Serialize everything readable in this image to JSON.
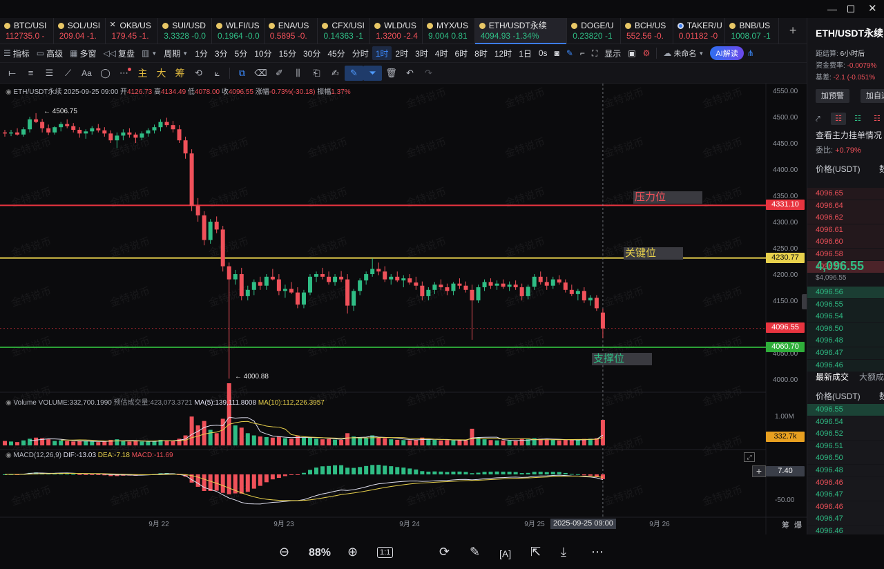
{
  "window": {
    "min_icon": "minimize-icon",
    "max_icon": "maximize-icon",
    "close_icon": "close-icon"
  },
  "tabs": [
    {
      "sym": "BTC/USI",
      "price": "112735.0",
      "chg": "-",
      "dir": "dn",
      "icon": "coin"
    },
    {
      "sym": "SOL/USI",
      "price": "209.04",
      "chg": "-1.",
      "dir": "dn",
      "icon": "coin"
    },
    {
      "sym": "OKB/US",
      "price": "179.45",
      "chg": "-1.",
      "dir": "dn",
      "icon": "x"
    },
    {
      "sym": "SUI/USD",
      "price": "3.3328",
      "chg": "-0.0",
      "dir": "up",
      "icon": "coin"
    },
    {
      "sym": "WLFI/US",
      "price": "0.1964",
      "chg": "-0.0",
      "dir": "up",
      "icon": "coin"
    },
    {
      "sym": "ENA/US",
      "price": "0.5895",
      "chg": "-0.",
      "dir": "dn",
      "icon": "coin"
    },
    {
      "sym": "CFX/USI",
      "price": "0.14363",
      "chg": "-1",
      "dir": "up",
      "icon": "coin"
    },
    {
      "sym": "WLD/US",
      "price": "1.3200",
      "chg": "-2.4",
      "dir": "dn",
      "icon": "coin"
    },
    {
      "sym": "MYX/US",
      "price": "9.004",
      "chg": "0.81",
      "dir": "up",
      "icon": "coin"
    },
    {
      "sym": "ETH/USDT永续",
      "price": "4094.93",
      "chg": "-1.34%",
      "dir": "up",
      "icon": "coin",
      "active": true
    },
    {
      "sym": "DOGE/U",
      "price": "0.23820",
      "chg": "-1",
      "dir": "up",
      "icon": "coin"
    },
    {
      "sym": "BCH/US",
      "price": "552.56",
      "chg": "-0.",
      "dir": "dn",
      "icon": "coin"
    },
    {
      "sym": "TAKER/U",
      "price": "0.01182",
      "chg": "-0",
      "dir": "dn",
      "icon": "b"
    },
    {
      "sym": "BNB/US",
      "price": "1008.07",
      "chg": "-1",
      "dir": "up",
      "icon": "coin"
    }
  ],
  "toolbar1": {
    "indicator": "指标",
    "advanced": "高级",
    "multi": "多窗",
    "replay": "复盘",
    "period": "周期",
    "intervals": [
      "1分",
      "3分",
      "5分",
      "10分",
      "15分",
      "30分",
      "45分",
      "分时",
      "1时",
      "2时",
      "3时",
      "4时",
      "6时",
      "8时",
      "12时",
      "1日"
    ],
    "selected_interval": "1时",
    "countdown": "0s",
    "display": "显示",
    "unnamed": "未命名",
    "ai": "AI解读"
  },
  "toolbar2": {
    "main": "主",
    "big": "大",
    "chip": "筹"
  },
  "chart": {
    "info": {
      "pair": "ETH/USDT永续",
      "time": "2025-09-25 09:00",
      "open_label": "开",
      "open": "4126.73",
      "high_label": "高",
      "high": "4134.49",
      "low_label": "低",
      "low": "4078.00",
      "close_label": "收",
      "close": "4096.55",
      "chg_label": "涨幅",
      "chg": "-0.73%(-30.18)",
      "amp_label": "振幅",
      "amp": "1.37%"
    },
    "volume_info": {
      "label": "Volume",
      "vol": "VOLUME:332,700.1990",
      "est": "预估成交量:423,073.3721",
      "ma5": "MA(5):139,111.8008",
      "ma10": "MA(10):112,226.3957"
    },
    "macd_info": {
      "label": "MACD(12,26,9)",
      "dif": "DIF:-13.03",
      "dea": "DEA:-7.18",
      "macd": "MACD:-11.69"
    },
    "levels": {
      "resistance": "压力位",
      "key": "关键位",
      "support": "支撑位"
    },
    "price_tags": {
      "resistance": "4331.10",
      "key": "4230.77",
      "current": "4096.55",
      "support": "4060.70",
      "volume": "332.7k",
      "macd": "7.40"
    },
    "annotations": {
      "high": "4506.75",
      "low": "4000.88"
    },
    "crosshair_date": "2025-09-25 09:00",
    "x_tail": [
      "筹",
      "爆"
    ],
    "watermark": "金特说币"
  },
  "chart_data": {
    "type": "candlestick",
    "pair": "ETH/USDT永续",
    "interval": "1时",
    "y_ticks": [
      4000,
      4050,
      4100,
      4150,
      4200,
      4250,
      4300,
      4350,
      4400,
      4450,
      4500,
      4550
    ],
    "ylim": [
      4000,
      4550
    ],
    "x_ticks": [
      "9月 22",
      "9月 23",
      "9月 24",
      "9月 25",
      "9月 26"
    ],
    "volume_ticks": [
      "1.00M"
    ],
    "macd_ticks": [
      "-50.00"
    ],
    "horizontal_levels": [
      {
        "name": "压力位",
        "price": 4331.1,
        "color": "#e8343f"
      },
      {
        "name": "关键位",
        "price": 4230.77,
        "color": "#e8d14c"
      },
      {
        "name": "支撑位",
        "price": 4060.7,
        "color": "#2fae3a"
      }
    ],
    "period_high": 4506.75,
    "period_low": 4000.88,
    "last_price": 4096.55,
    "candles": [
      [
        4470,
        4475,
        4462,
        4468,
        40
      ],
      [
        4468,
        4475,
        4463,
        4470,
        35
      ],
      [
        4470,
        4478,
        4464,
        4466,
        30
      ],
      [
        4466,
        4480,
        4462,
        4476,
        45
      ],
      [
        4476,
        4500,
        4470,
        4495,
        60
      ],
      [
        4495,
        4506.75,
        4488,
        4490,
        70
      ],
      [
        4490,
        4496,
        4470,
        4478,
        65
      ],
      [
        4478,
        4485,
        4465,
        4470,
        55
      ],
      [
        4470,
        4482,
        4466,
        4480,
        40
      ],
      [
        4480,
        4490,
        4472,
        4486,
        45
      ],
      [
        4486,
        4495,
        4478,
        4482,
        40
      ],
      [
        4482,
        4488,
        4470,
        4475,
        35
      ],
      [
        4475,
        4480,
        4460,
        4468,
        40
      ],
      [
        4468,
        4476,
        4458,
        4472,
        38
      ],
      [
        4472,
        4482,
        4466,
        4478,
        35
      ],
      [
        4478,
        4486,
        4470,
        4474,
        30
      ],
      [
        4474,
        4480,
        4462,
        4468,
        36
      ],
      [
        4468,
        4474,
        4450,
        4455,
        50
      ],
      [
        4455,
        4470,
        4440,
        4464,
        55
      ],
      [
        4464,
        4476,
        4455,
        4470,
        40
      ],
      [
        4470,
        4478,
        4460,
        4466,
        35
      ],
      [
        4466,
        4470,
        4450,
        4460,
        38
      ],
      [
        4460,
        4472,
        4455,
        4468,
        36
      ],
      [
        4468,
        4478,
        4462,
        4474,
        34
      ],
      [
        4474,
        4485,
        4468,
        4480,
        40
      ],
      [
        4480,
        4495,
        4472,
        4490,
        50
      ],
      [
        4490,
        4498,
        4480,
        4484,
        45
      ],
      [
        4484,
        4492,
        4470,
        4476,
        42
      ],
      [
        4476,
        4484,
        4450,
        4455,
        60
      ],
      [
        4455,
        4462,
        4420,
        4430,
        90
      ],
      [
        4430,
        4438,
        4320,
        4330,
        260
      ],
      [
        4330,
        4345,
        4300,
        4312,
        180
      ],
      [
        4312,
        4320,
        4255,
        4265,
        220
      ],
      [
        4265,
        4305,
        4258,
        4300,
        140
      ],
      [
        4300,
        4310,
        4278,
        4285,
        110
      ],
      [
        4285,
        4292,
        4205,
        4215,
        240
      ],
      [
        4215,
        4222,
        4000.88,
        4190,
        560
      ],
      [
        4190,
        4208,
        4180,
        4200,
        180
      ],
      [
        4200,
        4212,
        4150,
        4158,
        160
      ],
      [
        4158,
        4178,
        4150,
        4170,
        110
      ],
      [
        4170,
        4190,
        4160,
        4185,
        90
      ],
      [
        4185,
        4195,
        4170,
        4178,
        80
      ],
      [
        4178,
        4200,
        4170,
        4195,
        75
      ],
      [
        4195,
        4210,
        4188,
        4190,
        70
      ],
      [
        4190,
        4200,
        4160,
        4168,
        80
      ],
      [
        4168,
        4180,
        4155,
        4172,
        65
      ],
      [
        4172,
        4185,
        4162,
        4165,
        60
      ],
      [
        4165,
        4175,
        4135,
        4142,
        85
      ],
      [
        4142,
        4170,
        4135,
        4165,
        70
      ],
      [
        4165,
        4200,
        4160,
        4195,
        75
      ],
      [
        4195,
        4205,
        4185,
        4200,
        60
      ],
      [
        4200,
        4212,
        4190,
        4195,
        55
      ],
      [
        4195,
        4205,
        4180,
        4185,
        58
      ],
      [
        4185,
        4200,
        4178,
        4195,
        52
      ],
      [
        4195,
        4206,
        4185,
        4190,
        50
      ],
      [
        4190,
        4200,
        4125,
        4140,
        110
      ],
      [
        4140,
        4172,
        4130,
        4168,
        80
      ],
      [
        4168,
        4192,
        4160,
        4188,
        70
      ],
      [
        4188,
        4205,
        4180,
        4200,
        65
      ],
      [
        4200,
        4230,
        4195,
        4210,
        90
      ],
      [
        4210,
        4222,
        4198,
        4205,
        70
      ],
      [
        4205,
        4215,
        4185,
        4190,
        65
      ],
      [
        4190,
        4200,
        4180,
        4195,
        55
      ],
      [
        4195,
        4205,
        4185,
        4188,
        50
      ],
      [
        4188,
        4198,
        4175,
        4192,
        48
      ],
      [
        4192,
        4200,
        4180,
        4184,
        46
      ],
      [
        4184,
        4195,
        4170,
        4178,
        50
      ],
      [
        4178,
        4186,
        4150,
        4158,
        70
      ],
      [
        4158,
        4175,
        4150,
        4170,
        55
      ],
      [
        4170,
        4185,
        4162,
        4180,
        50
      ],
      [
        4180,
        4190,
        4170,
        4175,
        45
      ],
      [
        4175,
        4182,
        4160,
        4168,
        48
      ],
      [
        4168,
        4185,
        4160,
        4182,
        46
      ],
      [
        4182,
        4192,
        4172,
        4178,
        44
      ],
      [
        4178,
        4186,
        4165,
        4170,
        46
      ],
      [
        4170,
        4180,
        4075,
        4150,
        150
      ],
      [
        4150,
        4180,
        4145,
        4175,
        70
      ],
      [
        4175,
        4190,
        4168,
        4185,
        55
      ],
      [
        4185,
        4192,
        4172,
        4178,
        48
      ],
      [
        4178,
        4188,
        4170,
        4182,
        45
      ],
      [
        4182,
        4190,
        4172,
        4176,
        44
      ],
      [
        4176,
        4186,
        4168,
        4180,
        42
      ],
      [
        4180,
        4188,
        4170,
        4175,
        40
      ],
      [
        4175,
        4182,
        4150,
        4158,
        60
      ],
      [
        4158,
        4180,
        4152,
        4176,
        55
      ],
      [
        4176,
        4200,
        4170,
        4195,
        65
      ],
      [
        4195,
        4205,
        4180,
        4185,
        60
      ],
      [
        4185,
        4195,
        4170,
        4178,
        55
      ],
      [
        4178,
        4195,
        4172,
        4190,
        50
      ],
      [
        4190,
        4198,
        4180,
        4184,
        45
      ],
      [
        4184,
        4190,
        4165,
        4170,
        50
      ],
      [
        4170,
        4180,
        4158,
        4162,
        52
      ],
      [
        4162,
        4172,
        4150,
        4168,
        48
      ],
      [
        4168,
        4175,
        4145,
        4150,
        58
      ],
      [
        4150,
        4160,
        4140,
        4155,
        60
      ],
      [
        4155,
        4160,
        4130,
        4135,
        65
      ],
      [
        4126.73,
        4134.49,
        4078.0,
        4096.55,
        230
      ]
    ]
  },
  "right_panel": {
    "pair": "ETH/USDT永续",
    "settle_label": "距结算:",
    "settle": "6小时后",
    "funding_label": "资金费率:",
    "funding": "-0.0079%",
    "basis_label": "基差:",
    "basis": "-2.1 (-0.051%",
    "btn_alert": "加预警",
    "btn_watch": "加自选",
    "main_orders": "查看主力挂单情况",
    "ratio_label": "委比:",
    "ratio": "+0.79%",
    "price_header": "价格(USDT)",
    "qty_header": "数",
    "asks": [
      "4096.65",
      "4096.64",
      "4096.62",
      "4096.61",
      "4096.60",
      "4096.58",
      "4096.57"
    ],
    "last": "4,096.55",
    "last_usd": "$4,096.55",
    "bids": [
      "4096.56",
      "4096.55",
      "4096.54",
      "4096.50",
      "4096.48",
      "4096.47",
      "4096.46"
    ],
    "trades_tab": "最新成交",
    "big_tab": "大额成",
    "trades": [
      {
        "p": "4096.55",
        "d": "g"
      },
      {
        "p": "4096.54",
        "d": "g"
      },
      {
        "p": "4096.52",
        "d": "g"
      },
      {
        "p": "4096.51",
        "d": "g"
      },
      {
        "p": "4096.50",
        "d": "g"
      },
      {
        "p": "4096.48",
        "d": "g"
      },
      {
        "p": "4096.46",
        "d": "r"
      },
      {
        "p": "4096.47",
        "d": "g"
      },
      {
        "p": "4096.46",
        "d": "r"
      },
      {
        "p": "4096.47",
        "d": "g"
      },
      {
        "p": "4096.46",
        "d": "g"
      }
    ]
  },
  "bottom_bar": {
    "zoom": "88%",
    "actual": "1:1"
  }
}
